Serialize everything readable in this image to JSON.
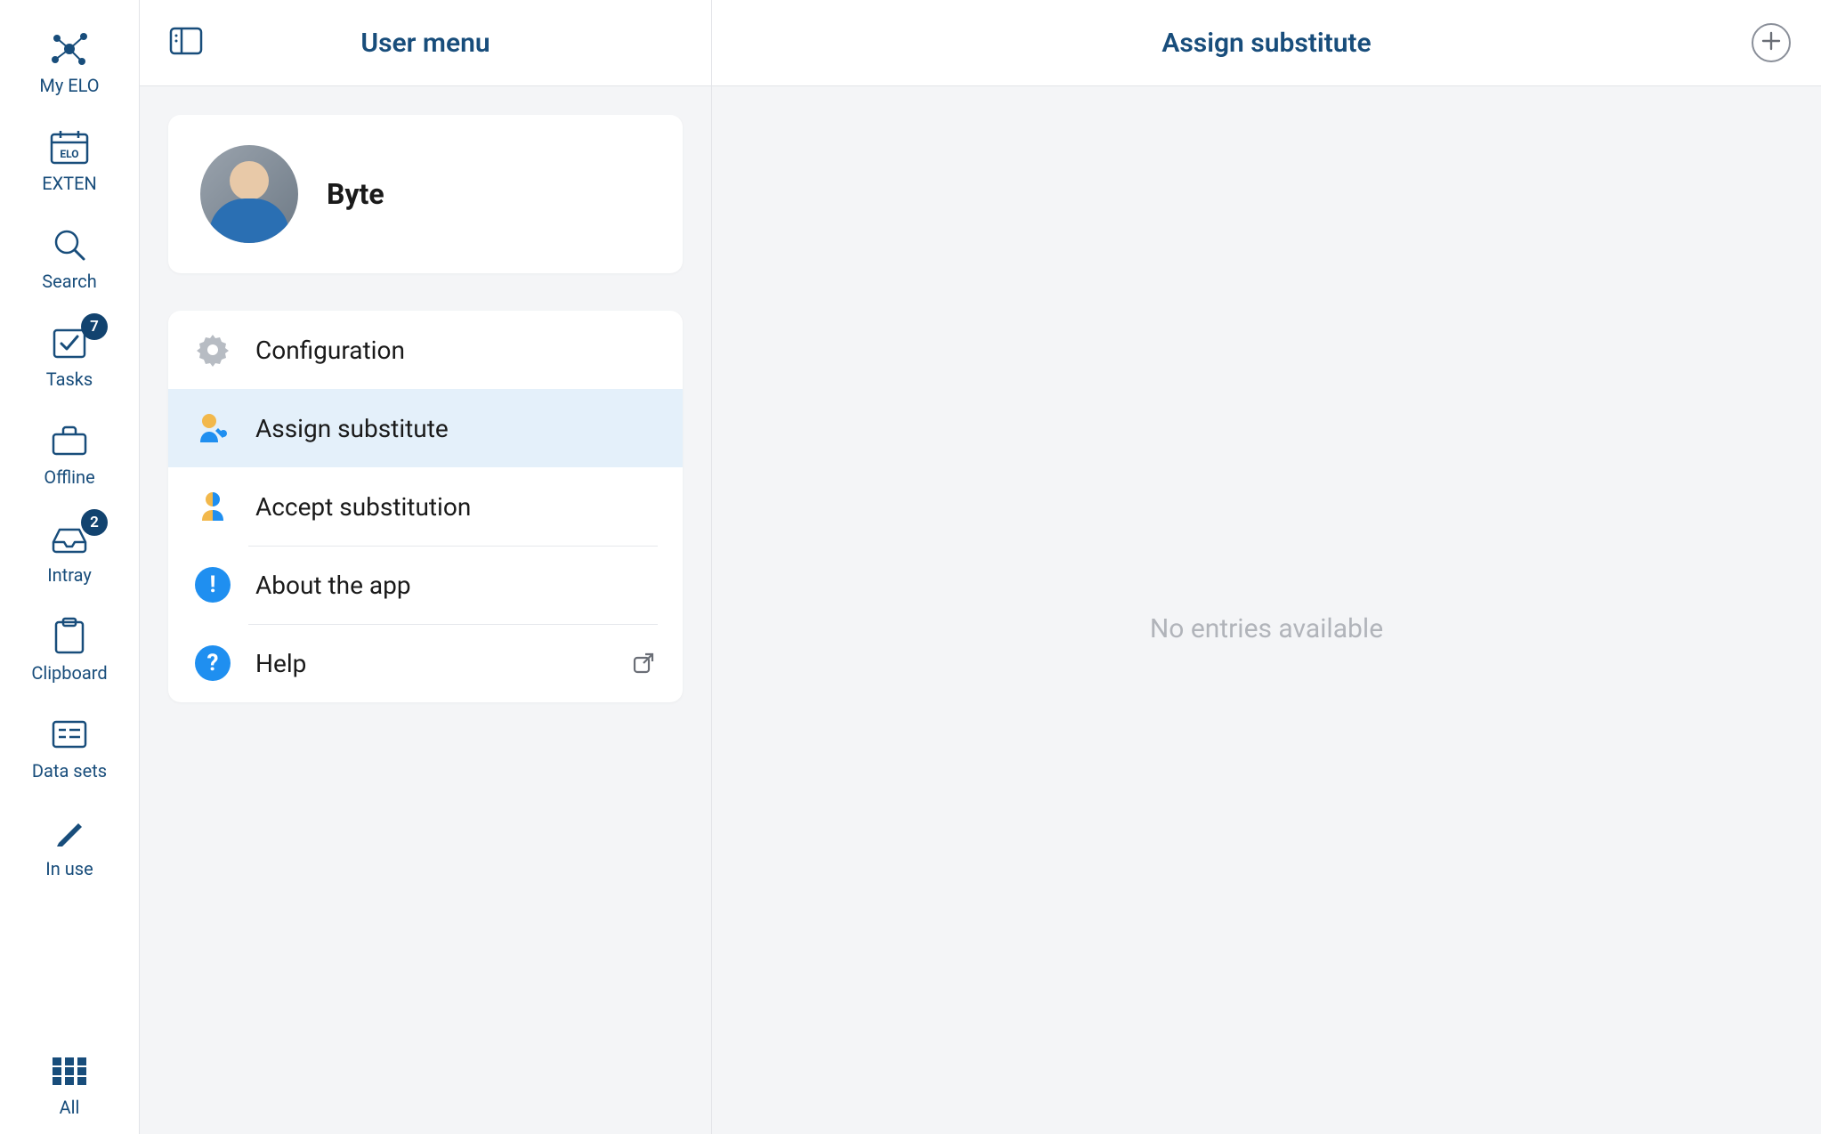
{
  "rail": {
    "items": [
      {
        "id": "myelo",
        "label": "My ELO",
        "badge": null
      },
      {
        "id": "exten",
        "label": "EXTEN",
        "badge": null
      },
      {
        "id": "search",
        "label": "Search",
        "badge": null
      },
      {
        "id": "tasks",
        "label": "Tasks",
        "badge": "7"
      },
      {
        "id": "offline",
        "label": "Offline",
        "badge": null
      },
      {
        "id": "intray",
        "label": "Intray",
        "badge": "2"
      },
      {
        "id": "clipboard",
        "label": "Clipboard",
        "badge": null
      },
      {
        "id": "datasets",
        "label": "Data sets",
        "badge": null
      },
      {
        "id": "inuse",
        "label": "In use",
        "badge": null
      }
    ],
    "bottom": {
      "id": "all",
      "label": "All"
    }
  },
  "menu": {
    "title": "User menu",
    "user": {
      "name": "Byte"
    },
    "items": [
      {
        "label": "Configuration",
        "icon": "gear-icon",
        "active": false
      },
      {
        "label": "Assign substitute",
        "icon": "user-wrench-icon",
        "active": true
      },
      {
        "label": "Accept substitution",
        "icon": "person-split-icon",
        "active": false
      },
      {
        "label": "About the app",
        "icon": "info-icon",
        "active": false
      },
      {
        "label": "Help",
        "icon": "help-icon",
        "active": false,
        "external": true
      }
    ]
  },
  "detail": {
    "title": "Assign substitute",
    "empty_message": "No entries available"
  }
}
